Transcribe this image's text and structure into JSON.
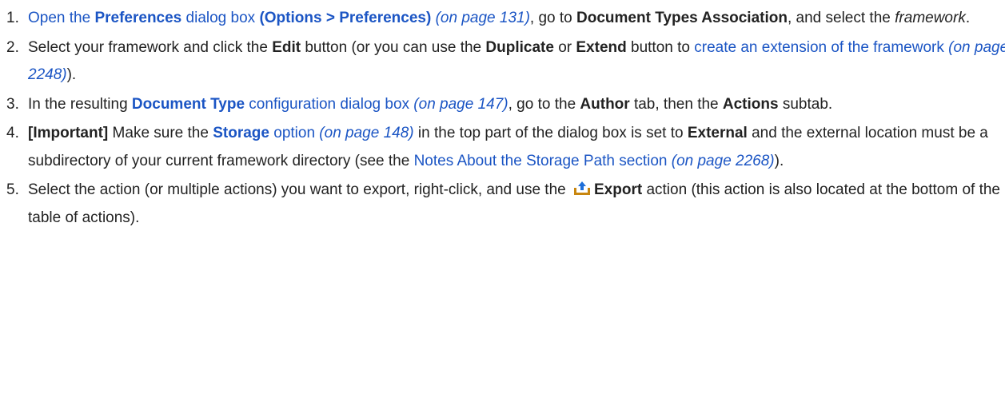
{
  "steps": [
    {
      "number": "1.",
      "t1": "Open the ",
      "t2": "Preferences",
      "t3": " dialog box ",
      "t4": "(Options > Preferences)",
      "t5": "(on page 131)",
      "t6": ", go to ",
      "t7": "Document Types Association",
      "t8": ", and select the ",
      "t9": "framework",
      "t10": "."
    },
    {
      "number": "2.",
      "t1": "Select your framework and click the ",
      "t2": "Edit",
      "t3": " button (or you can use the ",
      "t4": "Duplicate",
      "t5": " or ",
      "t6": "Extend",
      "t7": " button to ",
      "t8": "create an extension of the framework",
      "t9": "(on page 2248)",
      "t10": ")."
    },
    {
      "number": "3.",
      "t1": "In the resulting ",
      "t2": "Document Type",
      "t3": " configuration dialog box",
      "t4": "(on page 147)",
      "t5": ", go to the ",
      "t6": "Author",
      "t7": " tab, then the ",
      "t8": "Actions",
      "t9": " subtab."
    },
    {
      "number": "4.",
      "t1": "[Important]",
      "t2": " Make sure the ",
      "t3": "Storage",
      "t4": " option",
      "t5": "(on page 148)",
      "t6": " in the top part of the dialog box is set to ",
      "t7": "External",
      "t8": " and the external location must be a subdirectory of your current framework directory (see the ",
      "t9": "Notes About the Storage Path section",
      "t10": "(on page 2268)",
      "t11": ")."
    },
    {
      "number": "5.",
      "t1": "Select the action (or multiple actions) you want to export, right-click, and use the",
      "icon": "export-icon",
      "t2": "Export",
      "t3": " action (this action is also located at the bottom of the table of actions)."
    }
  ],
  "colors": {
    "link": "#1b55c4",
    "text": "#222222",
    "icon_tray": "#c8860f",
    "icon_arrow": "#1e6fd9"
  }
}
